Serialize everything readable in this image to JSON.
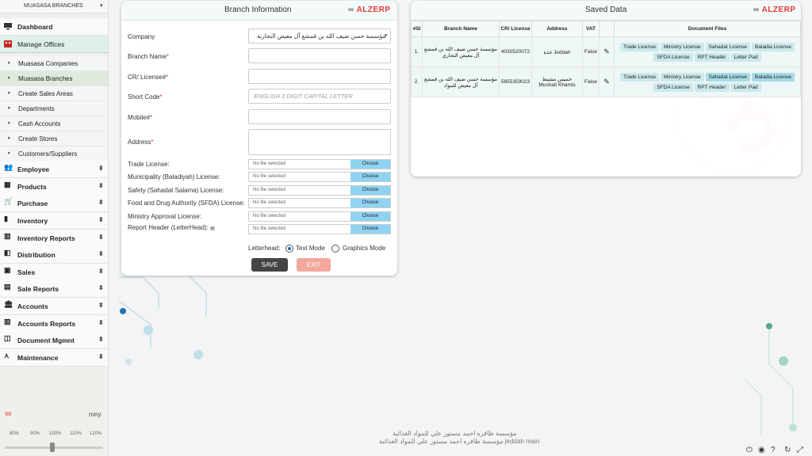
{
  "sidebar": {
    "top_label": "MUASASA BRANCHES",
    "dashboard": "Dashboard",
    "manage_offices": "Manage Offices",
    "sub_items": [
      "Muasasa Companies",
      "Muasasa Branches",
      "Create Sales Areas",
      "Departments",
      "Cash Accounts",
      "Create Stores",
      "Customers/Suppliers"
    ],
    "menu": [
      "Employee",
      "Products",
      "Purchase",
      "Inventory",
      "Inventory Reports",
      "Distribution",
      "Sales",
      "Sale Reports",
      "Accounts",
      "Accounts Reports",
      "Document Mgmnt",
      "Maintenance"
    ],
    "user": "rony",
    "zoom_levels": [
      "80%",
      "90%",
      "100%",
      "110%",
      "120%"
    ],
    "zoom_value": 100
  },
  "form": {
    "title": "Branch Information",
    "brand": "ALZERP",
    "company_label": "Company",
    "company_value": "مؤسسة حسن ضيف الله بن قمشع آل معيض التجارية",
    "branch_name_label": "Branch Name",
    "cr_label": "CR/ License#",
    "short_code_label": "Short Code",
    "short_code_placeholder": "ENGLISH 3 DIGIT CAPITAL LETTER",
    "mobile_label": "Mobile#",
    "address_label": "Address",
    "files": [
      {
        "label": "Trade License:"
      },
      {
        "label": "Municipality (Baladiyah) License:"
      },
      {
        "label": "Safety (Sahadat Salama) License:"
      },
      {
        "label": "Food and Drug Authority (SFDA) License:"
      },
      {
        "label": "Ministry Approval License:"
      },
      {
        "label": "Report Header (LetterHead):"
      }
    ],
    "no_file": "No file selected",
    "choose": "Choose",
    "letterhead_label": "Letterhead:",
    "text_mode": "Text Mode",
    "graphics_mode": "Graphics Mode",
    "save": "SAVE",
    "exit": "EXIT"
  },
  "saved": {
    "title": "Saved Data",
    "brand": "ALZERP",
    "headers": [
      "#SI",
      "Branch Name",
      "CR/ License",
      "Address",
      "VAT",
      "",
      "Document Files"
    ],
    "rows": [
      {
        "si": "1.",
        "name": "مؤسسة حسن ضيف الله بن قمشع آل معيض التجاري",
        "cr": "4030520072",
        "address": "جدة Jeddah",
        "vat": "False"
      },
      {
        "si": "2.",
        "name": "مؤسسة حسن ضيف الله بن قمشع آل معيض للمواد",
        "cr": "5855359023",
        "address": "خميس مشيط Mushait Khamis",
        "vat": "False"
      }
    ],
    "doc_row1": [
      "Trade License",
      "Ministry License",
      "Sahadat License",
      "Baladia License"
    ],
    "doc_row2": [
      "SFDA License",
      "RPT Header",
      "Letter Pad"
    ]
  },
  "footer": {
    "line1": "مؤسسة ظافره احمد مستور علي للمواد الغذائية",
    "line2": "مؤسسة ظافره احمد مستور علي للمواد الغذائية jeddah main"
  }
}
